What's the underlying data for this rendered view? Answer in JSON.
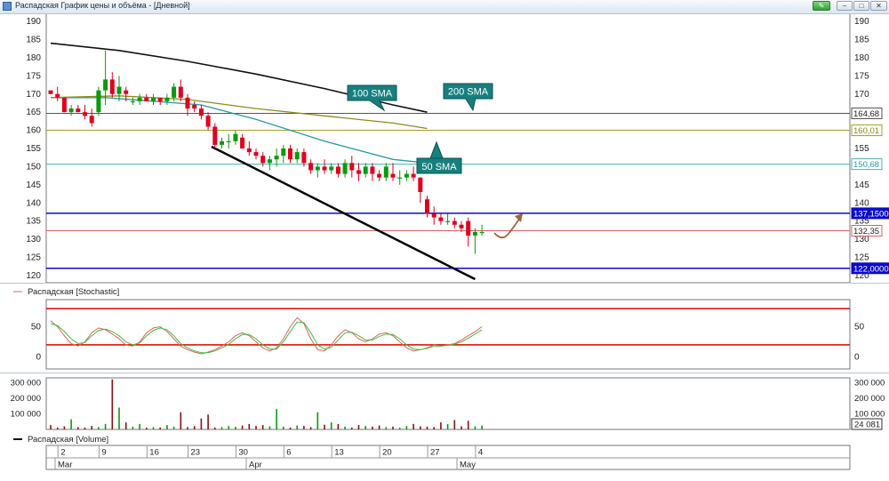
{
  "window": {
    "title": "Распадская График цены и объёма - [Дневной]",
    "buttons": {
      "minimize": "–",
      "maximize": "□",
      "close": "✕"
    }
  },
  "colors": {
    "up": "#0a9a0a",
    "down": "#e0001c",
    "sma50": "#2a9aa7",
    "sma100": "#8f8a1e",
    "sma200": "#111111",
    "blue_level": "#0a0ad0",
    "price_line": "#e06060",
    "stoch_level": "#e00000"
  },
  "chart_data": [
    {
      "type": "candlestick",
      "title": "",
      "y_ticks": [
        120,
        125,
        130,
        135,
        140,
        145,
        150,
        155,
        160,
        165,
        170,
        175,
        180,
        185,
        190
      ],
      "x_ticks": [
        "2",
        "9",
        "16",
        "23",
        "30",
        "6",
        "13",
        "20",
        "27",
        "4"
      ],
      "months": [
        "Mar",
        "Apr",
        "May"
      ],
      "ylim": [
        119,
        191
      ],
      "candles": [
        [
          171,
          171,
          170,
          170
        ],
        [
          170,
          172,
          168,
          169
        ],
        [
          169,
          169,
          165,
          165
        ],
        [
          165,
          167,
          164,
          166
        ],
        [
          166,
          167,
          165,
          165
        ],
        [
          165,
          167,
          163,
          164
        ],
        [
          164,
          166,
          161,
          162
        ],
        [
          165,
          172,
          164,
          171
        ],
        [
          171,
          182,
          167,
          174
        ],
        [
          174,
          176,
          169,
          170
        ],
        [
          170,
          175,
          168,
          172
        ],
        [
          171,
          172,
          168,
          170
        ],
        [
          168,
          169,
          167,
          168
        ],
        [
          168,
          170,
          167,
          169
        ],
        [
          169,
          170,
          168,
          168
        ],
        [
          168,
          170,
          167,
          169
        ],
        [
          169,
          169,
          167,
          168
        ],
        [
          168,
          170,
          167,
          169
        ],
        [
          169,
          173,
          168,
          172
        ],
        [
          172,
          174,
          168,
          169
        ],
        [
          169,
          170,
          164,
          166
        ],
        [
          167,
          168,
          165,
          166
        ],
        [
          166,
          167,
          163,
          164
        ],
        [
          164,
          165,
          160,
          161
        ],
        [
          161,
          162,
          155,
          156
        ],
        [
          156,
          158,
          155,
          157
        ],
        [
          157,
          159,
          155,
          157
        ],
        [
          157,
          160,
          156,
          159
        ],
        [
          158,
          159,
          155,
          155
        ],
        [
          155,
          157,
          153,
          154
        ],
        [
          154,
          155,
          152,
          153
        ],
        [
          153,
          154,
          150,
          151
        ],
        [
          151,
          153,
          149,
          152
        ],
        [
          152,
          155,
          150,
          153
        ],
        [
          153,
          156,
          151,
          155
        ],
        [
          155,
          156,
          151,
          152
        ],
        [
          152,
          155,
          151,
          154
        ],
        [
          154,
          155,
          150,
          151
        ],
        [
          151,
          152,
          148,
          149
        ],
        [
          149,
          151,
          147,
          150
        ],
        [
          150,
          152,
          148,
          149
        ],
        [
          149,
          151,
          148,
          150
        ],
        [
          150,
          151,
          147,
          148
        ],
        [
          148,
          152,
          147,
          151
        ],
        [
          151,
          153,
          147,
          149
        ],
        [
          149,
          151,
          146,
          148
        ],
        [
          148,
          151,
          147,
          150
        ],
        [
          150,
          151,
          146,
          148
        ],
        [
          148,
          149,
          146,
          147
        ],
        [
          147,
          151,
          146,
          150
        ],
        [
          148,
          151,
          146,
          147
        ],
        [
          147,
          149,
          145,
          147
        ],
        [
          147,
          149,
          146,
          148
        ],
        [
          148,
          150,
          146,
          147
        ],
        [
          147,
          147,
          140,
          143
        ],
        [
          141,
          142,
          136,
          137
        ],
        [
          137,
          139,
          134,
          136
        ],
        [
          136,
          137,
          134,
          135
        ],
        [
          135,
          137,
          134,
          135
        ],
        [
          135,
          136,
          133,
          134
        ],
        [
          134,
          135,
          132,
          133
        ],
        [
          135,
          136,
          128,
          131
        ],
        [
          131,
          133,
          126,
          132
        ],
        [
          132,
          134,
          131,
          132
        ]
      ],
      "sma": [
        {
          "name": "50 SMA",
          "points": [
            [
              0,
              169
            ],
            [
              8,
              169
            ],
            [
              22,
              167
            ],
            [
              30,
              163
            ],
            [
              40,
              157
            ],
            [
              50,
              152
            ],
            [
              55,
              151
            ]
          ]
        },
        {
          "name": "100 SMA",
          "points": [
            [
              0,
              169
            ],
            [
              10,
              169.5
            ],
            [
              20,
              168.5
            ],
            [
              30,
              166
            ],
            [
              40,
              164
            ],
            [
              50,
              162
            ],
            [
              55,
              160.5
            ]
          ]
        },
        {
          "name": "200 SMA",
          "points": [
            [
              0,
              184
            ],
            [
              10,
              182
            ],
            [
              20,
              179
            ],
            [
              30,
              175.5
            ],
            [
              40,
              171.5
            ],
            [
              50,
              167
            ],
            [
              55,
              165
            ]
          ]
        }
      ],
      "levels": [
        {
          "value": 164.68,
          "label": "164,68"
        },
        {
          "value": 160.01,
          "label": "160,01"
        },
        {
          "value": 150.68,
          "label": "150,68"
        },
        {
          "value": 137.15,
          "label": "137,15000"
        },
        {
          "value": 132.35,
          "label": "132,35"
        },
        {
          "value": 122.0,
          "label": "122,00000"
        }
      ],
      "trendline": [
        [
          23.5,
          155.5
        ],
        [
          62,
          119
        ]
      ]
    },
    {
      "type": "line",
      "title": "Распадская [Stochastic]",
      "y_ticks": [
        0,
        50
      ],
      "ylim": [
        -20,
        95
      ],
      "levels": [
        80,
        20
      ],
      "series": [
        {
          "values": [
            60,
            50,
            35,
            22,
            18,
            25,
            40,
            48,
            45,
            38,
            30,
            20,
            18,
            25,
            40,
            48,
            50,
            42,
            30,
            18,
            12,
            8,
            5,
            8,
            12,
            18,
            25,
            35,
            40,
            35,
            25,
            15,
            10,
            15,
            30,
            50,
            65,
            55,
            30,
            12,
            10,
            20,
            35,
            45,
            40,
            30,
            25,
            30,
            38,
            40,
            35,
            25,
            15,
            10,
            12,
            15,
            20,
            18,
            20,
            22,
            28,
            35,
            42,
            50
          ]
        },
        {
          "values": [
            55,
            52,
            42,
            30,
            22,
            24,
            35,
            44,
            46,
            42,
            35,
            25,
            20,
            23,
            35,
            44,
            48,
            45,
            35,
            22,
            15,
            10,
            7,
            7,
            10,
            15,
            21,
            30,
            37,
            37,
            30,
            20,
            13,
            13,
            25,
            42,
            58,
            57,
            40,
            20,
            13,
            16,
            28,
            40,
            41,
            35,
            28,
            28,
            34,
            38,
            37,
            30,
            20,
            13,
            12,
            14,
            18,
            18,
            19,
            21,
            25,
            31,
            38,
            45
          ]
        }
      ]
    },
    {
      "type": "bar",
      "title": "Распадская [Volume]",
      "y_ticks": [
        100000,
        200000,
        300000
      ],
      "tick_labels": [
        "100 000",
        "200 000",
        "300 000"
      ],
      "last_value_label": "24 081",
      "ylim": [
        0,
        330000
      ],
      "values": [
        28000,
        12000,
        20000,
        65000,
        15000,
        12000,
        22000,
        15000,
        35000,
        320000,
        140000,
        45000,
        18000,
        35000,
        12000,
        15000,
        12000,
        28000,
        18000,
        110000,
        15000,
        22000,
        70000,
        95000,
        12000,
        15000,
        22000,
        18000,
        25000,
        35000,
        22000,
        28000,
        20000,
        130000,
        18000,
        12000,
        25000,
        22000,
        15000,
        110000,
        30000,
        45000,
        35000,
        18000,
        12000,
        28000,
        22000,
        18000,
        25000,
        15000,
        18000,
        12000,
        22000,
        35000,
        20000,
        18000,
        15000,
        45000,
        35000,
        60000,
        20000,
        55000,
        20000,
        25000
      ]
    }
  ]
}
